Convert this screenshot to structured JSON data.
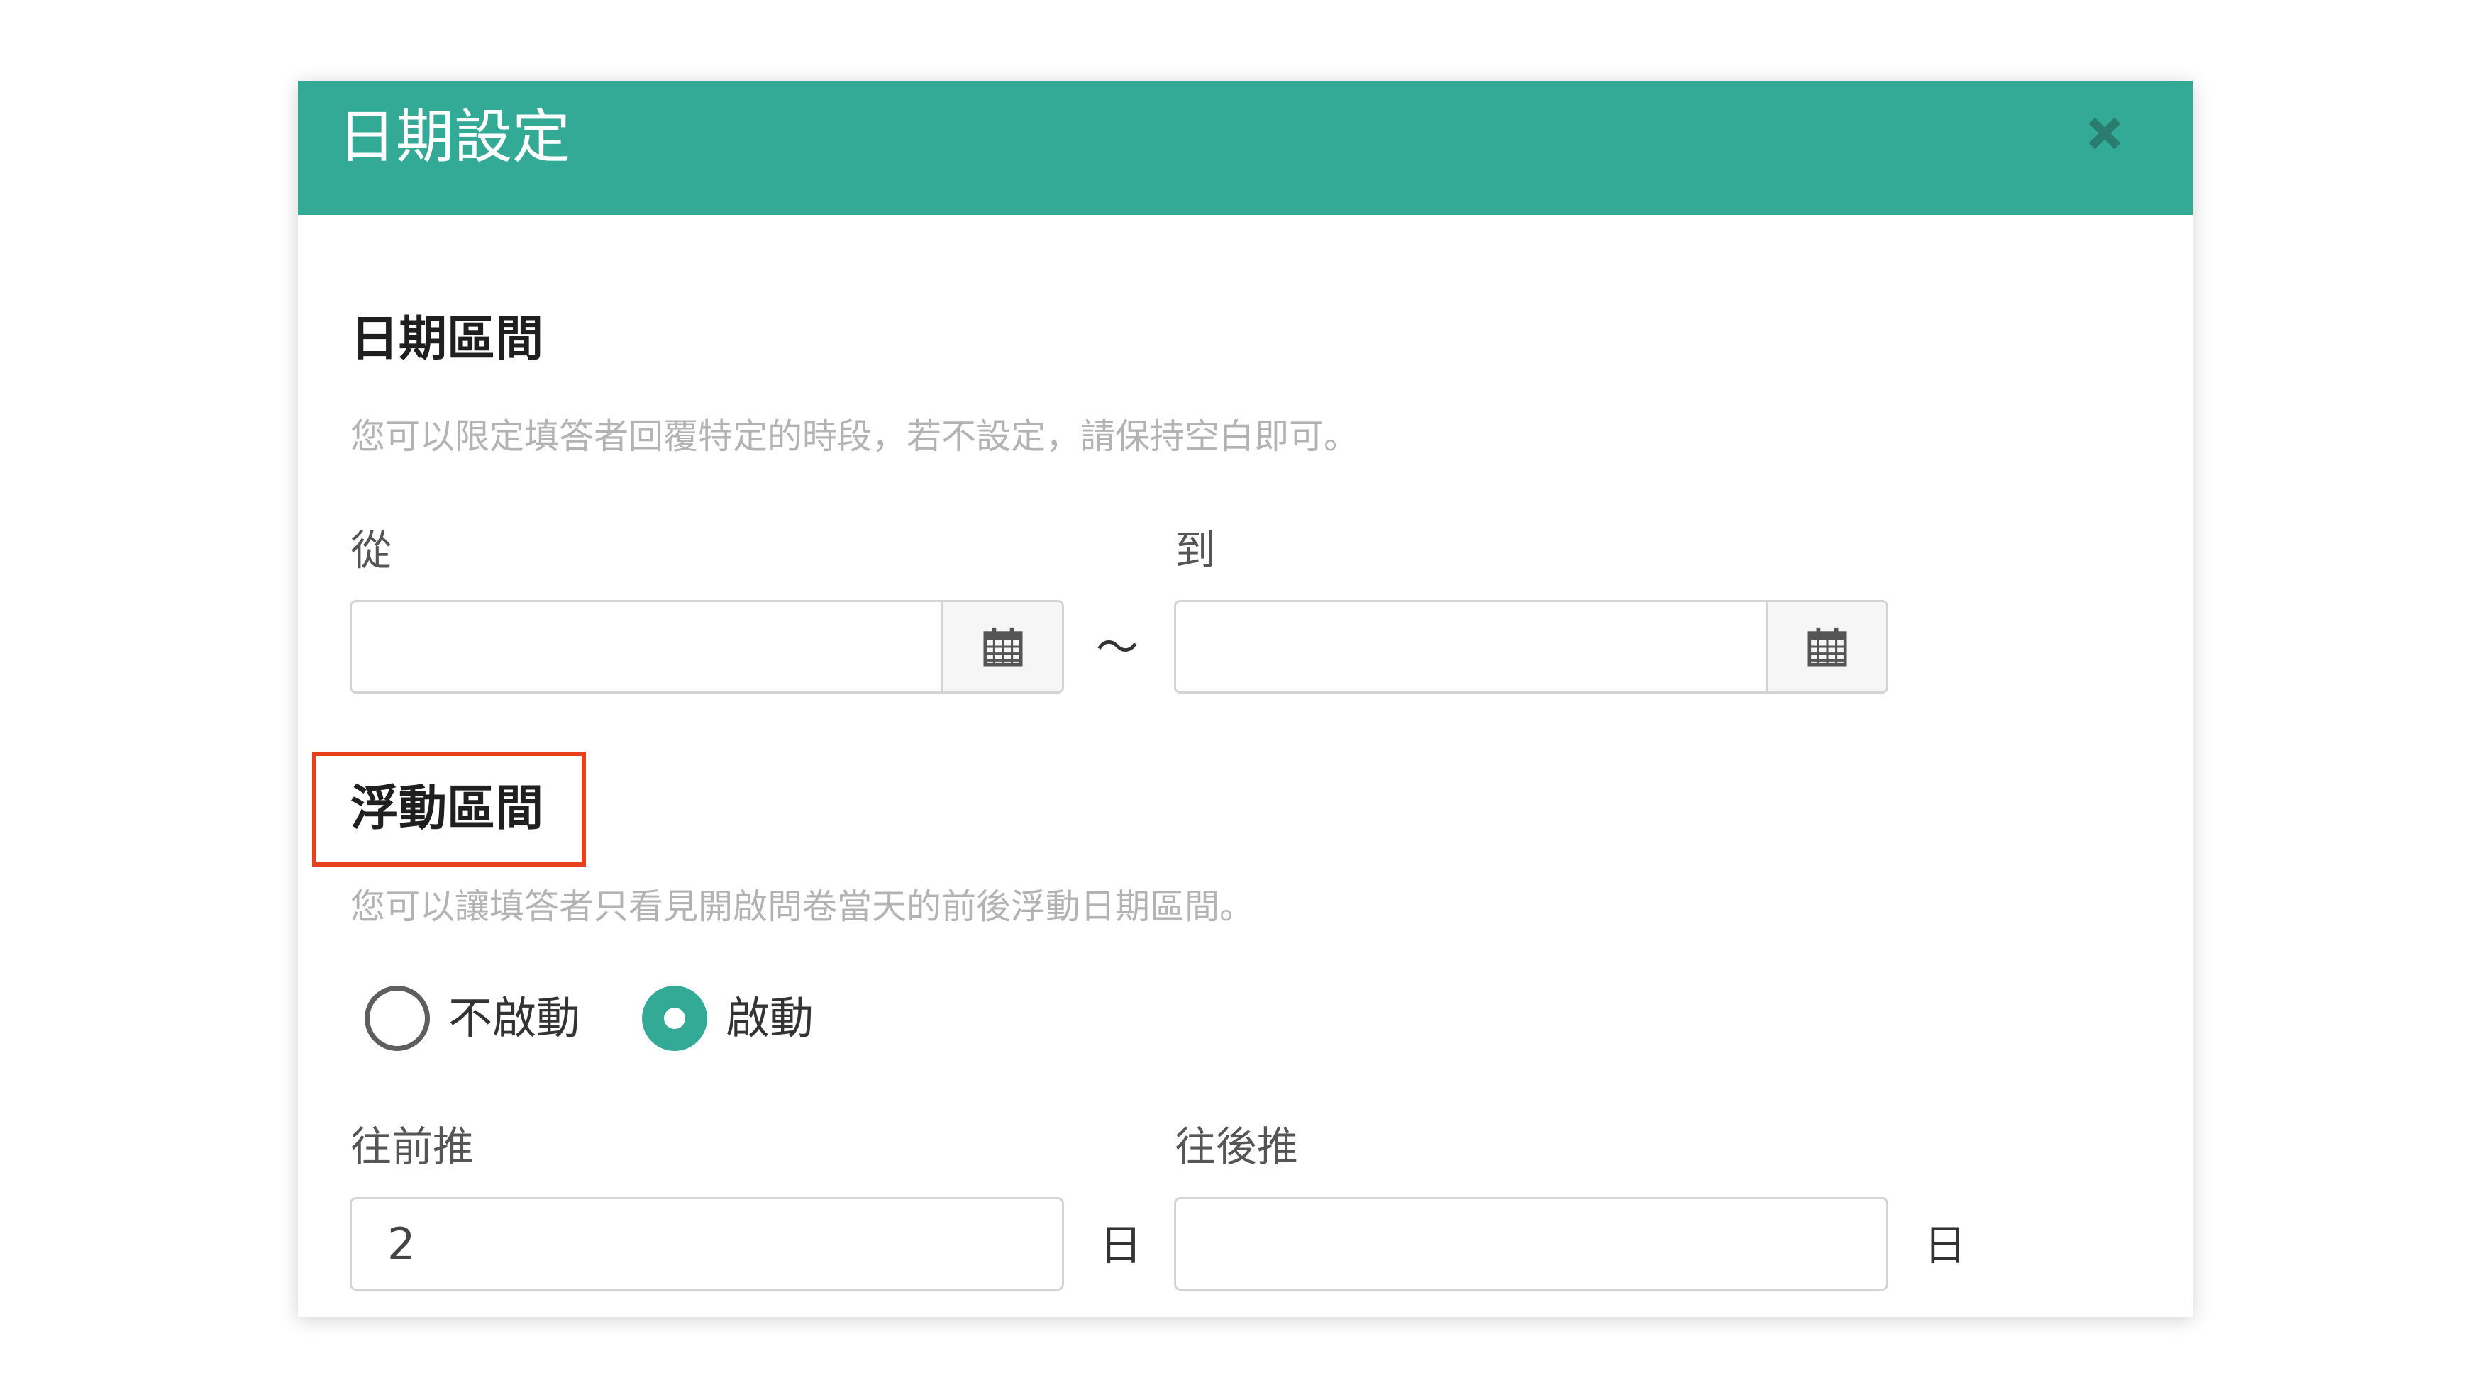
{
  "dialog": {
    "title": "日期設定"
  },
  "date_range": {
    "title": "日期區間",
    "hint": "您可以限定填答者回覆特定的時段，若不設定，請保持空白即可。",
    "from_label": "從",
    "to_label": "到",
    "from_value": "",
    "to_value": "",
    "separator": "～"
  },
  "floating_range": {
    "title": "浮動區間",
    "hint": "您可以讓填答者只看見開啟問卷當天的前後浮動日期區間。",
    "options": [
      {
        "label": "不啟動",
        "selected": false
      },
      {
        "label": "啟動",
        "selected": true
      }
    ],
    "before_label": "往前推",
    "after_label": "往後推",
    "before_value": "2",
    "after_value": "",
    "unit": "日"
  },
  "colors": {
    "header": "#33aa95",
    "accent": "#33aa95",
    "highlight": "#e8401c"
  },
  "icons": {
    "close": "close-icon",
    "calendar": "calendar-icon"
  }
}
